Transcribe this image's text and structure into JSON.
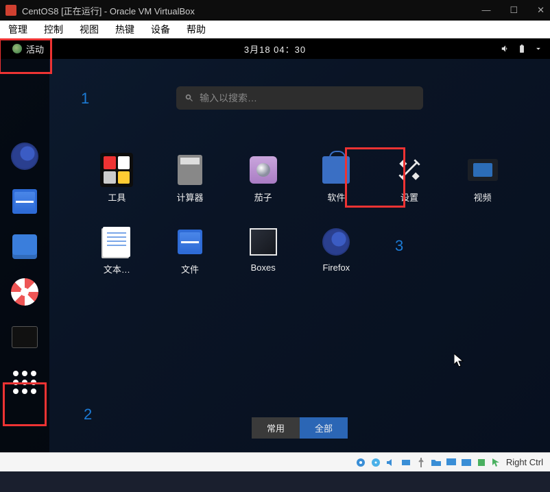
{
  "vb": {
    "title": "CentOS8 [正在运行] - Oracle VM VirtualBox",
    "menu": [
      "管理",
      "控制",
      "视图",
      "热键",
      "设备",
      "帮助"
    ],
    "host_key": "Right Ctrl"
  },
  "gnome": {
    "activities": "活动",
    "clock": "3月18 04：30"
  },
  "search": {
    "placeholder": "输入以搜索…"
  },
  "apps_row1": [
    {
      "name": "toolbox",
      "label": "工具"
    },
    {
      "name": "calculator",
      "label": "计算器"
    },
    {
      "name": "cheese",
      "label": "茄子"
    },
    {
      "name": "software",
      "label": "软件"
    },
    {
      "name": "settings",
      "label": "设置"
    },
    {
      "name": "videos",
      "label": "视频"
    }
  ],
  "apps_row2": [
    {
      "name": "text-editor",
      "label": "文本…"
    },
    {
      "name": "files",
      "label": "文件"
    },
    {
      "name": "boxes",
      "label": "Boxes"
    },
    {
      "name": "firefox",
      "label": "Firefox"
    }
  ],
  "segmented": {
    "frequent": "常用",
    "all": "全部"
  },
  "annotations": {
    "n1": "1",
    "n2": "2",
    "n3": "3"
  }
}
